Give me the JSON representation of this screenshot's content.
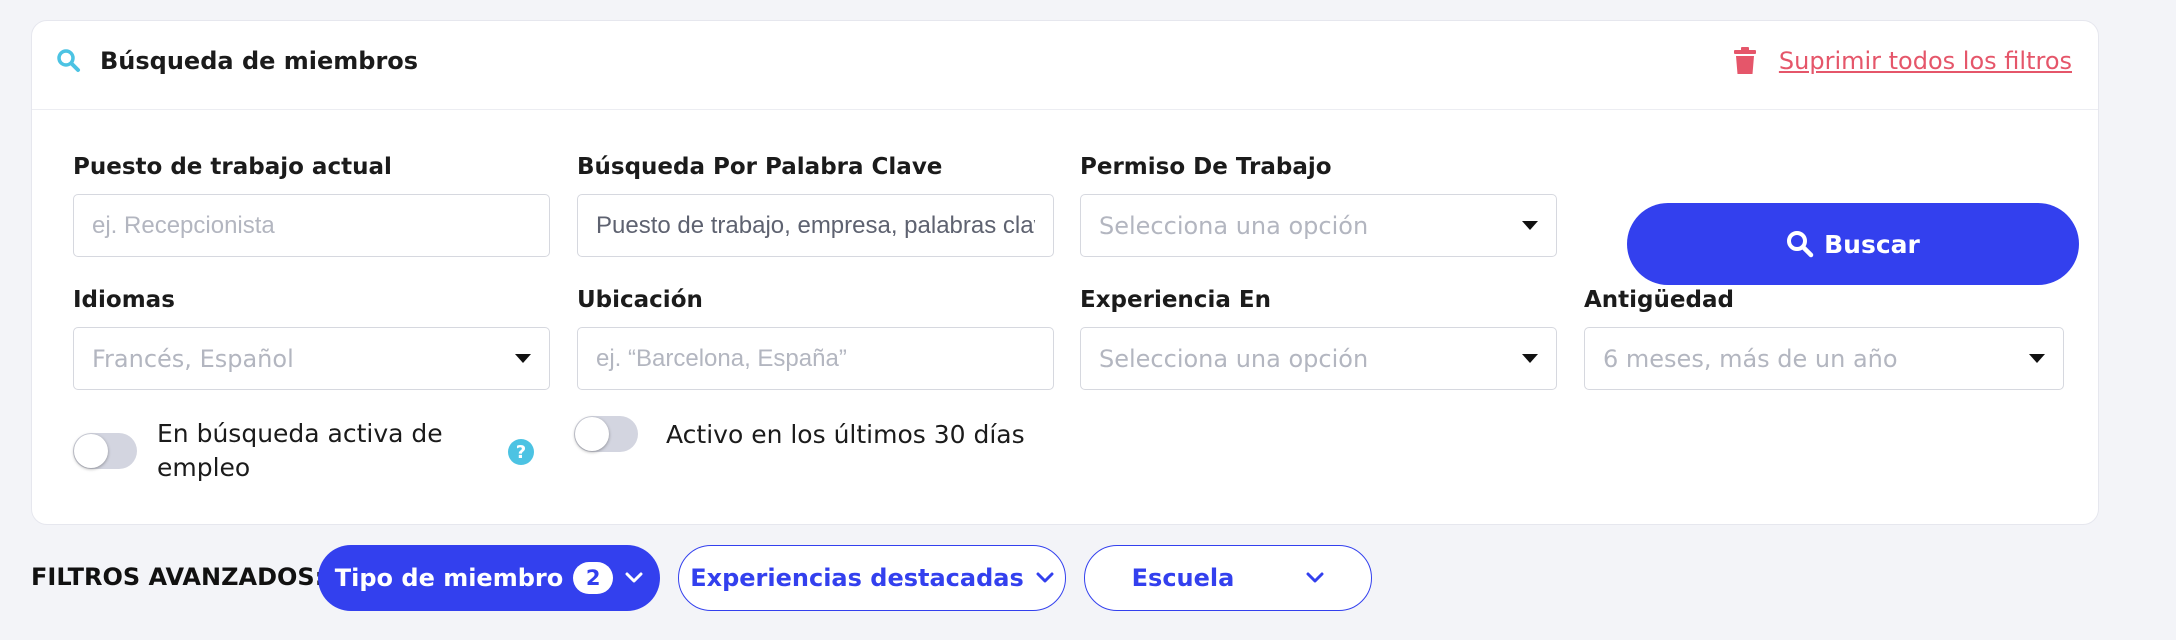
{
  "header": {
    "title": "Búsqueda de miembros",
    "clear_all": "Suprimir todos los filtros"
  },
  "filters": {
    "job_title": {
      "label": "Puesto de trabajo actual",
      "placeholder": "ej. Recepcionista"
    },
    "keyword": {
      "label": "Búsqueda Por Palabra Clave",
      "placeholder": "Puesto de trabajo, empresa, palabras clave"
    },
    "work_permit": {
      "label": "Permiso De Trabajo",
      "placeholder": "Selecciona una opción"
    },
    "languages": {
      "label": "Idiomas",
      "placeholder": "Francés, Español"
    },
    "location": {
      "label": "Ubicación",
      "placeholder": "ej. “Barcelona, España”"
    },
    "experience": {
      "label": "Experiencia En",
      "placeholder": "Selecciona una opción"
    },
    "seniority": {
      "label": "Antigüedad",
      "placeholder": "6 meses, más de un año"
    }
  },
  "search_button": "Buscar",
  "toggles": {
    "active_search": {
      "label_line1": "En búsqueda activa de",
      "label_line2": "empleo",
      "on": false
    },
    "active_30_days": {
      "label": "Activo en los últimos 30 días",
      "on": false
    }
  },
  "help_icon": "?",
  "advanced": {
    "label": "FILTROS AVANZADOS:",
    "pills": [
      {
        "label": "Tipo de miembro",
        "count": "2",
        "active": true
      },
      {
        "label": "Experiencias destacadas",
        "active": false
      },
      {
        "label": "Escuela",
        "active": false
      }
    ]
  },
  "colors": {
    "accent": "#3340ee",
    "danger": "#e5566a",
    "help": "#4cc3e3"
  },
  "icons": [
    "search-icon",
    "trash-icon",
    "caret-down-icon",
    "chevron-down-icon",
    "help-icon"
  ]
}
